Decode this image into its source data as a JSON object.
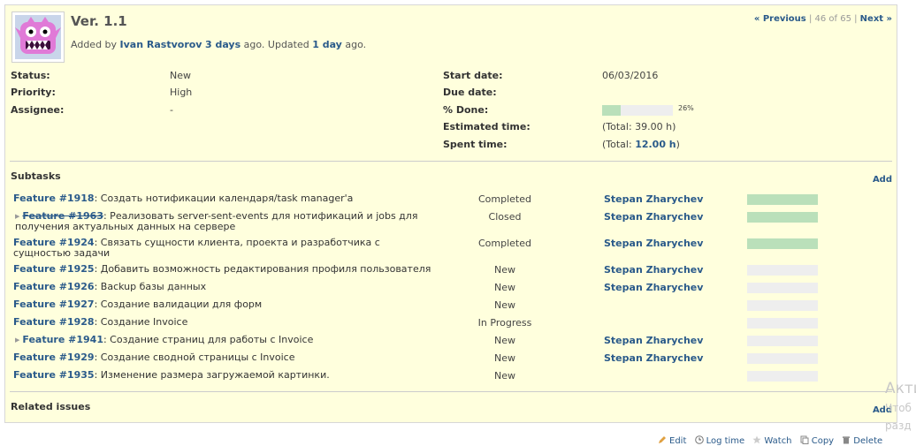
{
  "issue": {
    "title": "Ver. 1.1",
    "author_prefix": "Added by",
    "author": "Ivan Rastvorov",
    "created_ago": "3 days",
    "ago_text": "ago. Updated",
    "updated_ago": "1 day",
    "ago_end": "ago."
  },
  "nav": {
    "previous": "« Previous",
    "counter": "| 46 of 65 |",
    "next": "Next »"
  },
  "attributes": {
    "status_label": "Status:",
    "status_value": "New",
    "priority_label": "Priority:",
    "priority_value": "High",
    "assignee_label": "Assignee:",
    "assignee_value": "-",
    "start_label": "Start date:",
    "start_value": "06/03/2016",
    "due_label": "Due date:",
    "due_value": "",
    "done_label": "% Done:",
    "done_percent": 26,
    "done_text": "26%",
    "estimated_label": "Estimated time:",
    "estimated_value": "(Total: 39.00 h)",
    "spent_label": "Spent time:",
    "spent_prefix": "(Total:",
    "spent_value": "12.00 h",
    "spent_suffix": ")"
  },
  "subtasks": {
    "title": "Subtasks",
    "add": "Add",
    "rows": [
      {
        "id": "Feature #1918",
        "text": ": Создать нотификации календаря/task manager'a",
        "status": "Completed",
        "assignee": "Stepan Zharychev",
        "done": 100,
        "closed": false,
        "child": false
      },
      {
        "id": "Feature #1963",
        "text": ": Реализовать server-sent-events для нотификаций и jobs для получения актуальных данных на сервере",
        "status": "Closed",
        "assignee": "Stepan Zharychev",
        "done": 100,
        "closed": true,
        "child": true
      },
      {
        "id": "Feature #1924",
        "text": ": Связать сущности клиента, проекта и разработчика с сущностью задачи",
        "status": "Completed",
        "assignee": "Stepan Zharychev",
        "done": 100,
        "closed": false,
        "child": false
      },
      {
        "id": "Feature #1925",
        "text": ": Добавить возможность редактирования профиля пользователя",
        "status": "New",
        "assignee": "Stepan Zharychev",
        "done": 0,
        "closed": false,
        "child": false
      },
      {
        "id": "Feature #1926",
        "text": ": Backup базы данных",
        "status": "New",
        "assignee": "Stepan Zharychev",
        "done": 0,
        "closed": false,
        "child": false
      },
      {
        "id": "Feature #1927",
        "text": ": Создание валидации для форм",
        "status": "New",
        "assignee": "",
        "done": 0,
        "closed": false,
        "child": false
      },
      {
        "id": "Feature #1928",
        "text": ": Создание Invoice",
        "status": "In Progress",
        "assignee": "",
        "done": 0,
        "closed": false,
        "child": false
      },
      {
        "id": "Feature #1941",
        "text": ": Создание страниц для работы с Invoice",
        "status": "New",
        "assignee": "Stepan Zharychev",
        "done": 0,
        "closed": false,
        "child": true
      },
      {
        "id": "Feature #1929",
        "text": ": Создание сводной страницы с Invoice",
        "status": "New",
        "assignee": "Stepan Zharychev",
        "done": 0,
        "closed": false,
        "child": false
      },
      {
        "id": "Feature #1935",
        "text": ": Изменение размера загружаемой картинки.",
        "status": "New",
        "assignee": "",
        "done": 0,
        "closed": false,
        "child": false
      }
    ]
  },
  "related": {
    "title": "Related issues",
    "add": "Add"
  },
  "actions": {
    "edit": "Edit",
    "log_time": "Log time",
    "watch": "Watch",
    "copy": "Copy",
    "delete": "Delete"
  },
  "watermark": {
    "line1": "Акти",
    "line2": "Чтоб",
    "line3": "разд"
  },
  "colors": {
    "background": "#ffffdd",
    "link": "#2a5a8a",
    "progress_done": "#bae0ba",
    "progress_empty": "#eeeeee"
  }
}
